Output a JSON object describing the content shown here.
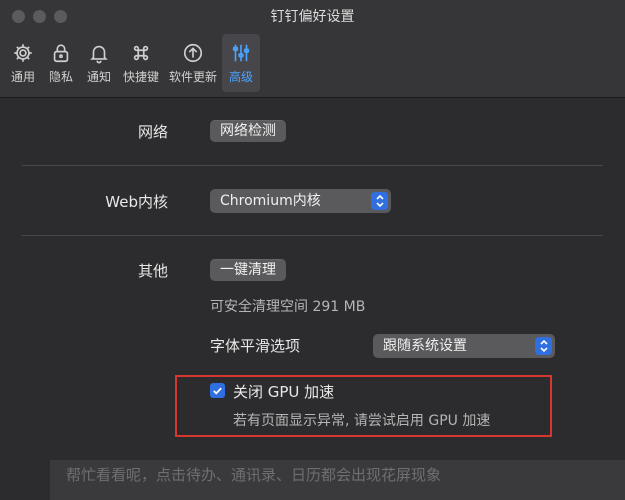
{
  "window": {
    "title": "钉钉偏好设置"
  },
  "tabs": [
    {
      "label": "通用",
      "icon": "gear-icon"
    },
    {
      "label": "隐私",
      "icon": "lock-icon"
    },
    {
      "label": "通知",
      "icon": "bell-icon"
    },
    {
      "label": "快捷键",
      "icon": "command-icon"
    },
    {
      "label": "软件更新",
      "icon": "arrow-up-circle-icon"
    },
    {
      "label": "高级",
      "icon": "sliders-icon",
      "active": true
    }
  ],
  "network": {
    "label": "网络",
    "button": "网络检测"
  },
  "web_engine": {
    "label": "Web内核",
    "selected": "Chromium内核"
  },
  "other": {
    "label": "其他",
    "clean_button": "一键清理",
    "clean_info": "可安全清理空间 291 MB",
    "font_smoothing_label": "字体平滑选项",
    "font_smoothing_selected": "跟随系统设置"
  },
  "gpu": {
    "checkbox_label": "关闭 GPU 加速",
    "checked": true,
    "hint": "若有页面显示异常, 请尝试启用 GPU 加速"
  },
  "background_text": "帮忙看看呢，点击待办、通讯录、日历都会出现花屏现象",
  "colors": {
    "accent": "#2f6fe0",
    "active_tab": "#4aa3ff",
    "highlight_border": "#d6382f"
  }
}
